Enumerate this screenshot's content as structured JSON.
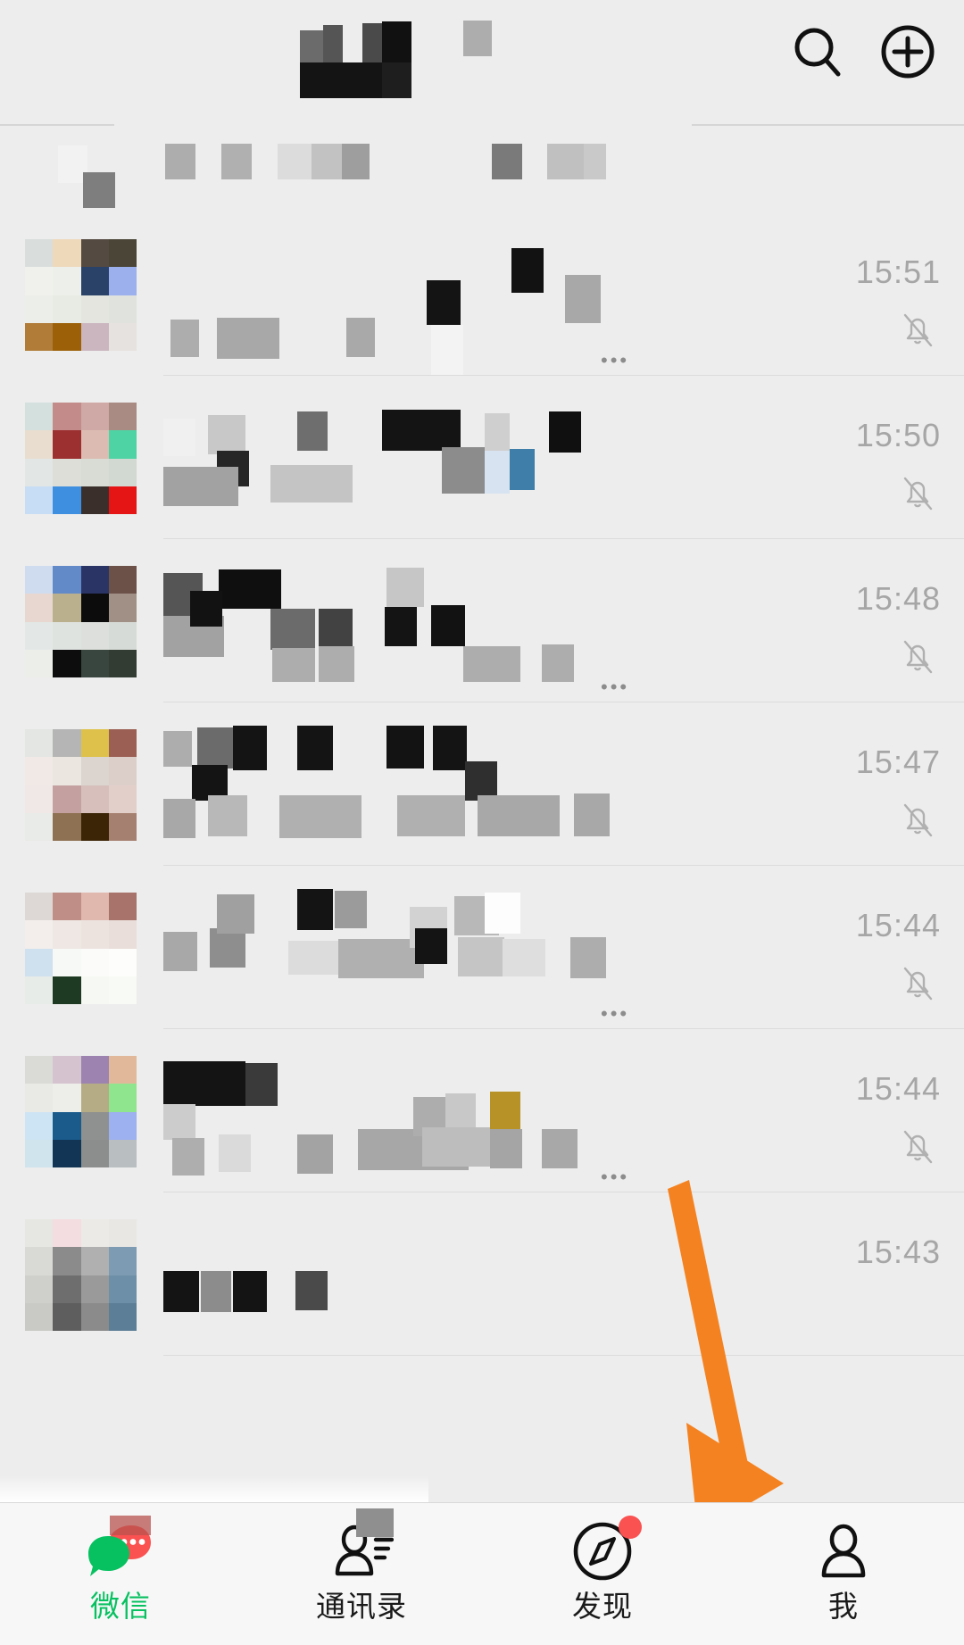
{
  "app": {
    "name": "WeChat",
    "accent_green": "#07C160",
    "badge_red": "#FA5151",
    "annotation_orange": "#F58220",
    "background": "#EDEDED",
    "tabbar_background": "#F7F7F7",
    "time_color": "#A6A6A6"
  },
  "header": {
    "title": "",
    "title_redacted": true,
    "search_icon": "search-icon",
    "add_icon": "plus-circle-icon"
  },
  "notice": {
    "text": "",
    "redacted": true
  },
  "chats": [
    {
      "time": "15:51",
      "muted": true,
      "name_redacted": true,
      "preview_redacted": true,
      "has_ellipsis": true,
      "avatar": [
        "#d9dedc",
        "#eed9bb",
        "#554a41",
        "#4a4536",
        "#f0f1ec",
        "#edf0ea",
        "#2a4168",
        "#9cb0ee",
        "#eceee9",
        "#e8ebe3",
        "#e3e5de",
        "#dfe2dd",
        "#b07c38",
        "#9c6108",
        "#cbb6bf",
        "#e6e2e0"
      ]
    },
    {
      "time": "15:50",
      "muted": true,
      "name_redacted": true,
      "preview_redacted": true,
      "has_ellipsis": false,
      "avatar": [
        "#d3e0dd",
        "#c38c8b",
        "#cfa9a6",
        "#a98b84",
        "#e8ddcf",
        "#9c2f30",
        "#dcbcb2",
        "#4ed3a4",
        "#e2e7e5",
        "#ddded8",
        "#d8dcd4",
        "#d2d8d2",
        "#c7dcf5",
        "#3f8fe0",
        "#3b2f2c",
        "#e61515"
      ]
    },
    {
      "time": "15:48",
      "muted": true,
      "name_redacted": true,
      "preview_redacted": true,
      "has_ellipsis": true,
      "avatar": [
        "#cfdcf0",
        "#6289c8",
        "#2a3566",
        "#6b5148",
        "#e8d7d0",
        "#bab08e",
        "#0c0c0c",
        "#a09086",
        "#e3e8e6",
        "#dfe3e0",
        "#dcdfdb",
        "#d7dbd7",
        "#eceeea",
        "#0d0d0d",
        "#39463f",
        "#323c33"
      ]
    },
    {
      "time": "15:47",
      "muted": true,
      "name_redacted": true,
      "preview_redacted": true,
      "has_ellipsis": false,
      "avatar": [
        "#e3e6e3",
        "#b5b5b5",
        "#ddc14b",
        "#9b5f54",
        "#f0e9e6",
        "#ece6e1",
        "#dcd4cf",
        "#dccfc9",
        "#efe8e6",
        "#c4a1a0",
        "#d7c0bb",
        "#e3cfca",
        "#e9ebe8",
        "#8e7152",
        "#3b2506",
        "#a58070"
      ]
    },
    {
      "time": "15:44",
      "muted": true,
      "name_redacted": true,
      "preview_redacted": true,
      "has_ellipsis": true,
      "avatar": [
        "#ddd8d5",
        "#bf8e86",
        "#e0b8ae",
        "#a8736a",
        "#f3eeeb",
        "#efe7e3",
        "#ece3df",
        "#e9ded9",
        "#cfe0ef",
        "#f7f9f6",
        "#fbfcf9",
        "#fdfefb",
        "#e8ece8",
        "#1f3a22",
        "#f6f8f4",
        "#f8faf6"
      ]
    },
    {
      "time": "15:44",
      "muted": true,
      "name_redacted": true,
      "preview_redacted": true,
      "has_ellipsis": true,
      "avatar": [
        "#dadad6",
        "#d6c3d0",
        "#9c83b0",
        "#e2b89b",
        "#e9e9e6",
        "#ededea",
        "#b5ab85",
        "#8fe58d",
        "#cde4f4",
        "#1a5b8c",
        "#8e918f",
        "#9db0ef",
        "#cfe4ec",
        "#123556",
        "#8b8e8c",
        "#b9bec1"
      ]
    },
    {
      "time": "15:43",
      "muted": false,
      "name_redacted": true,
      "preview_redacted": true,
      "has_ellipsis": false,
      "avatar": [
        "#e6e6e2",
        "#f4dde0",
        "#eceae7",
        "#e9e7e4",
        "#d9d9d5",
        "#8b8b8b",
        "#b0b0b0",
        "#7d9cb3",
        "#cfcfcb",
        "#6e6e6e",
        "#9a9a9a",
        "#6d8fa8",
        "#c9c9c5",
        "#5e5e5e",
        "#8b8b8b",
        "#5c7e96"
      ]
    }
  ],
  "tabs": [
    {
      "label": "微信",
      "icon": "chat-bubbles-icon",
      "active": true,
      "badge": "redacted-bubble"
    },
    {
      "label": "通讯录",
      "icon": "contacts-person-icon",
      "active": false,
      "badge": "redacted-gray"
    },
    {
      "label": "发现",
      "icon": "compass-icon",
      "active": false,
      "badge": "red-dot"
    },
    {
      "label": "我",
      "icon": "person-icon",
      "active": false,
      "badge": null
    }
  ],
  "annotation": {
    "type": "arrow",
    "points_to": "我",
    "color": "#F58220"
  }
}
